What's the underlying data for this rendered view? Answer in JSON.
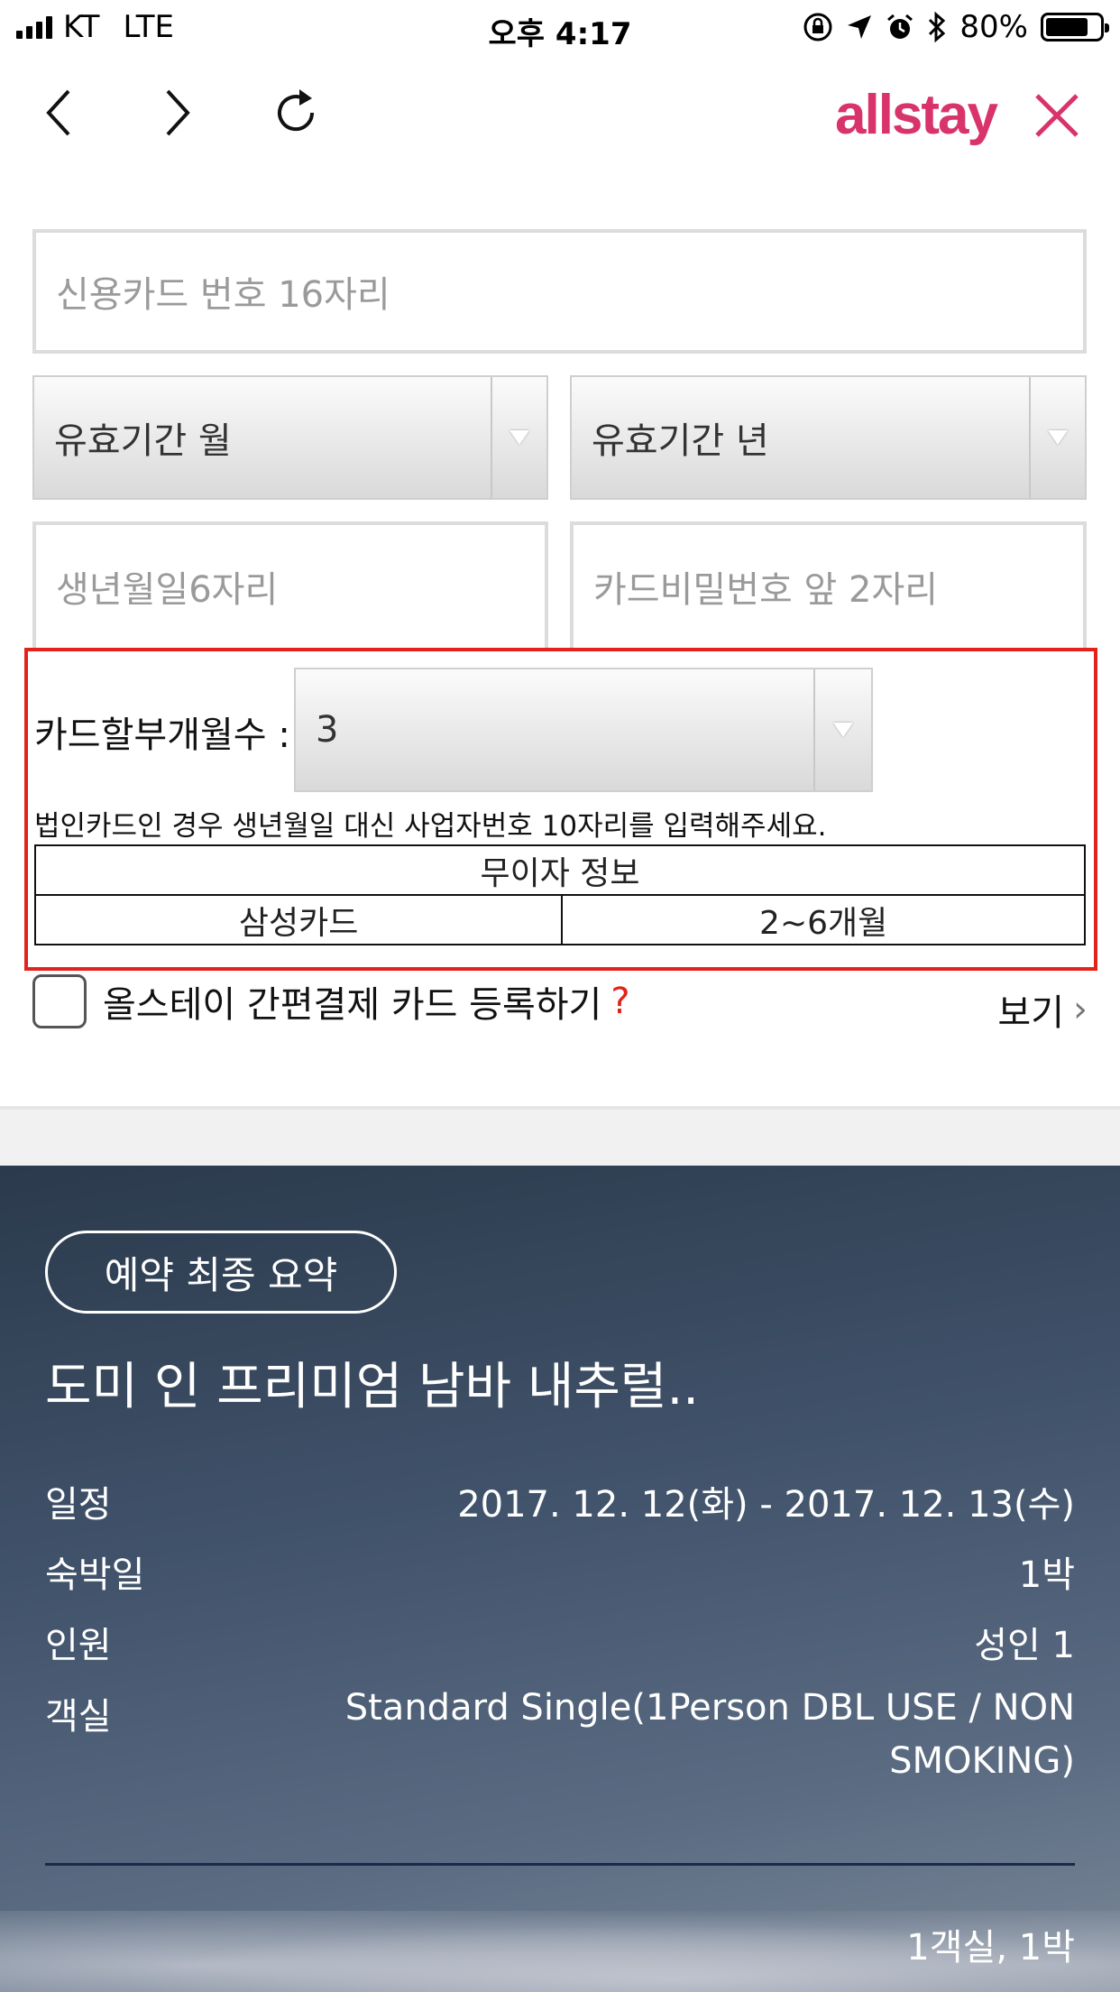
{
  "status_bar": {
    "carrier": "KT",
    "network": "LTE",
    "time": "오후 4:17",
    "battery": "80%",
    "battery_level": 0.8
  },
  "nav": {
    "logo": "allstay"
  },
  "form": {
    "card_number_placeholder": "신용카드 번호 16자리",
    "expiry_month": "유효기간 월",
    "expiry_year": "유효기간 년",
    "birthdate_placeholder": "생년월일6자리",
    "card_password_placeholder": "카드비밀번호 앞 2자리",
    "installment_label": "카드할부개월수 :",
    "installment_value": "3",
    "corporate_note": "법인카드인 경우 생년월일 대신 사업자번호 10자리를 입력해주세요.",
    "interest_free": {
      "header": "무이자 정보",
      "rows": [
        {
          "card": "삼성카드",
          "months": "2~6개월"
        }
      ]
    },
    "register_label": "올스테이 간편결제 카드 등록하기",
    "register_help": "?",
    "view_label": "보기",
    "view_chevron": "›"
  },
  "summary": {
    "badge": "예약 최종 요약",
    "hotel_name": "도미 인 프리미엄 남바 내추럴..",
    "schedule_label": "일정",
    "schedule_value": "2017. 12. 12(화) - 2017. 12. 13(수)",
    "nights_label": "숙박일",
    "nights_value": "1박",
    "guests_label": "인원",
    "guests_value": "성인 1",
    "room_label": "객실",
    "room_value_line1": "Standard Single(1Person DBL USE / NON",
    "room_value_line2": "SMOKING)",
    "total_label": "1객실, 1박"
  },
  "colors": {
    "brand": "#d8336a",
    "highlight_border": "#e3231b"
  }
}
